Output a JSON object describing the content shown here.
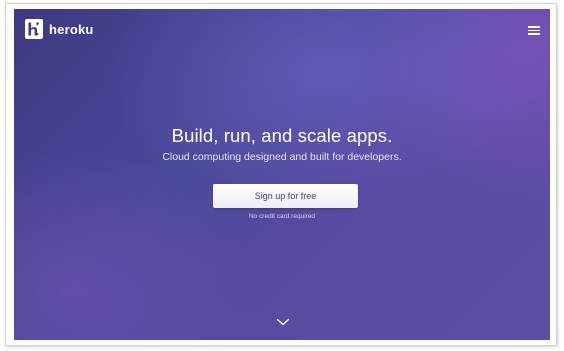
{
  "brand": {
    "name": "heroku",
    "logo_icon": "heroku-logo-icon"
  },
  "nav": {
    "menu_icon": "hamburger-menu-icon"
  },
  "hero": {
    "headline": "Build, run, and scale apps.",
    "subheadline": "Cloud computing designed and built for developers.",
    "cta_label": "Sign up for free",
    "cta_note": "No credit card required",
    "scroll_icon": "chevron-down-icon"
  },
  "colors": {
    "hero_background": "#4a4a9c",
    "hero_accent": "#5e4ea6",
    "cta_text": "#3f3a78",
    "text": "#ffffff"
  }
}
